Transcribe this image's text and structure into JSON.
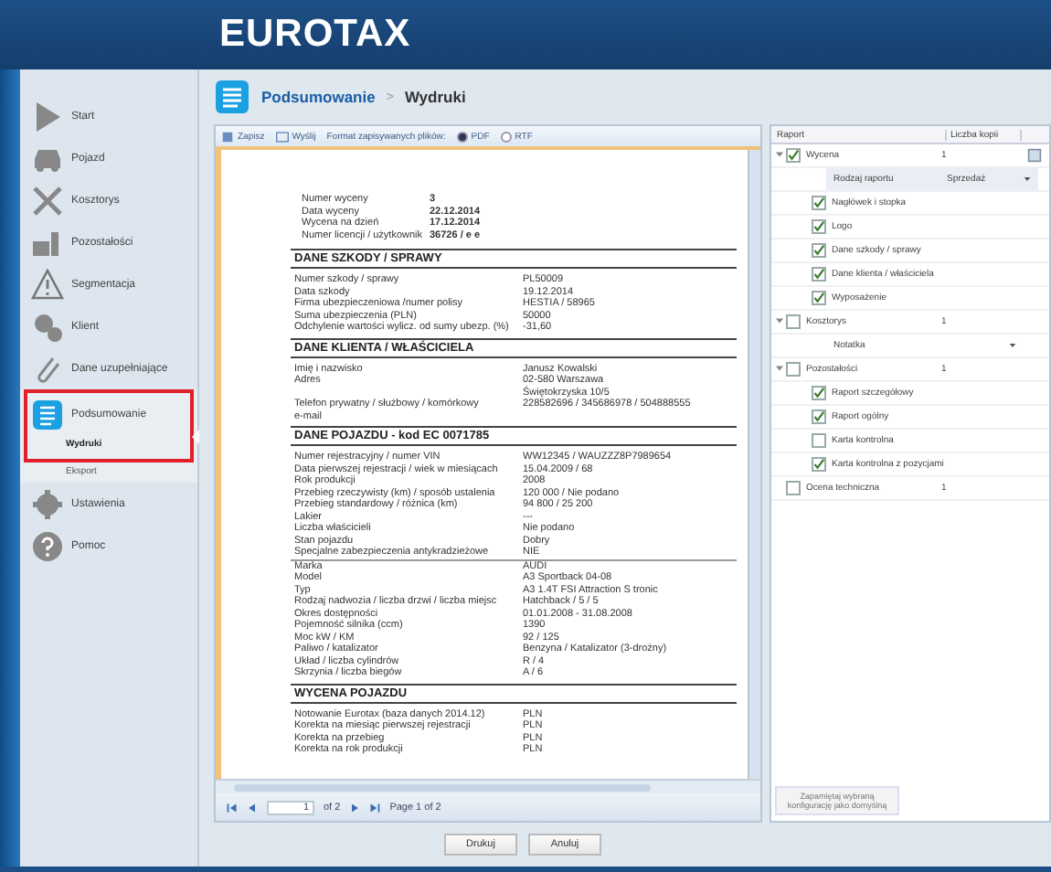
{
  "app": {
    "logo": "EUROTAX"
  },
  "sidebar": {
    "items": [
      {
        "label": "Start",
        "selected": false
      },
      {
        "label": "Pojazd",
        "selected": false
      },
      {
        "label": "Kosztorys",
        "selected": false
      },
      {
        "label": "Pozostałości",
        "selected": false
      },
      {
        "label": "Segmentacja",
        "selected": false
      },
      {
        "label": "Klient",
        "selected": false
      },
      {
        "label": "Dane uzupełniające",
        "selected": false
      },
      {
        "label": "Podsumowanie",
        "selected": true,
        "children": [
          {
            "label": "Wydruki",
            "selected": true
          },
          {
            "label": "Eksport",
            "selected": false
          }
        ]
      },
      {
        "label": "Ustawienia",
        "selected": false
      },
      {
        "label": "Pomoc",
        "selected": false
      }
    ]
  },
  "breadcrumb": [
    "Podsumowanie",
    ">",
    "Wydruki"
  ],
  "toolbar": {
    "save": "Zapisz",
    "send": "Wyślij",
    "format_label": "Format zapisywanych plików:",
    "formats": [
      {
        "label": "PDF",
        "selected": true
      },
      {
        "label": "RTF",
        "selected": false
      }
    ]
  },
  "document": {
    "header": [
      {
        "label": "Numer wyceny",
        "value": "3"
      },
      {
        "label": "Data wyceny",
        "value": "22.12.2014"
      },
      {
        "label": "Wycena na dzień",
        "value": "17.12.2014"
      },
      {
        "label": "Numer licencji / użytkownik",
        "value": "36726 / e e"
      }
    ],
    "sections": [
      {
        "title": "DANE SZKODY / SPRAWY",
        "rows": [
          {
            "label": "Numer szkody / sprawy",
            "value": "PL50009"
          },
          {
            "label": "Data szkody",
            "value": "19.12.2014"
          },
          {
            "label": "Firma ubezpieczeniowa /numer polisy",
            "value": "HESTIA / 58965"
          },
          {
            "label": "Suma ubezpieczenia (PLN)",
            "value": "50000"
          },
          {
            "label": "Odchylenie wartości wylicz. od sumy ubezp. (%)",
            "value": "-31,60"
          }
        ]
      },
      {
        "title": "DANE KLIENTA / WŁAŚCICIELA",
        "rows": [
          {
            "label": "Imię i nazwisko",
            "value": "Janusz Kowalski"
          },
          {
            "label": "Adres",
            "value": "02-580 Warszawa\nŚwiętokrzyska 10/5"
          },
          {
            "label": "Telefon prywatny / służbowy / komórkowy",
            "value": "228582696 / 345686978 / 504888555"
          },
          {
            "label": "e-mail"
          }
        ]
      },
      {
        "title": "DANE POJAZDU - kod EC 0071785",
        "rows": [
          {
            "label": "Numer rejestracyjny / numer VIN",
            "value": "WW12345 / WAUZZZ8P7989654"
          },
          {
            "label": "Data pierwszej rejestracji / wiek w miesiącach",
            "value": "15.04.2009 /  68"
          },
          {
            "label": "Rok produkcji",
            "value": "2008"
          },
          {
            "label": "Przebieg rzeczywisty (km) / sposób ustalenia",
            "value": "120 000 / Nie podano"
          },
          {
            "label": "Przebieg standardowy / różnica (km)",
            "value": "94 800 / 25 200"
          },
          {
            "label": "Lakier",
            "value": "---"
          },
          {
            "label": "Liczba właścicieli",
            "value": "Nie podano"
          },
          {
            "label": "Stan pojazdu",
            "value": "Dobry"
          },
          {
            "label": "Specjalne zabezpieczenia antykradzieżowe",
            "value": "NIE",
            "rule": true
          },
          {
            "label": "Marka",
            "value": "AUDI"
          },
          {
            "label": "Model",
            "value": "A3 Sportback 04-08"
          },
          {
            "label": "Typ",
            "value": "A3 1.4T FSI Attraction S tronic"
          },
          {
            "label": "Rodzaj nadwozia / liczba drzwi / liczba miejsc",
            "value": "Hatchback / 5 / 5"
          },
          {
            "label": "Okres dostępności",
            "value": "01.01.2008 - 31.08.2008"
          },
          {
            "label": "Pojemność silnika (ccm)",
            "value": "1390"
          },
          {
            "label": "Moc kW / KM",
            "value": "92 / 125"
          },
          {
            "label": "Paliwo / katalizator",
            "value": "Benzyna / Katalizator (3-drożny)"
          },
          {
            "label": "Układ / liczba cylindrów",
            "value": "R / 4"
          },
          {
            "label": "Skrzynia / liczba biegów",
            "value": "A / 6"
          }
        ]
      },
      {
        "title": "WYCENA POJAZDU",
        "rows": [
          {
            "label": "Notowanie Eurotax (baza danych 2014.12)",
            "value": "PLN"
          },
          {
            "label": "Korekta na miesiąc pierwszej rejestracji",
            "value": "PLN"
          },
          {
            "label": "Korekta na przebieg",
            "value": "PLN"
          },
          {
            "label": "Korekta na rok produkcji",
            "value": "PLN"
          }
        ]
      }
    ]
  },
  "pager": {
    "page": "1",
    "of": "of 2",
    "status": "Page 1 of 2"
  },
  "report_tree": {
    "columns": [
      "Raport",
      "Liczba kopii"
    ],
    "items": [
      {
        "label": "Wycena",
        "checked": true,
        "expanded": true,
        "copies": "1",
        "preview_icon": true,
        "children": [
          {
            "kind": "option",
            "label": "Rodzaj raportu",
            "value": "Sprzedaż"
          },
          {
            "kind": "check",
            "label": "Nagłówek i stopka",
            "checked": true
          },
          {
            "kind": "check",
            "label": "Logo",
            "checked": true
          },
          {
            "kind": "check",
            "label": "Dane szkody / sprawy",
            "checked": true
          },
          {
            "kind": "check",
            "label": "Dane klienta / właściciela",
            "checked": true
          },
          {
            "kind": "check",
            "label": "Wyposażenie",
            "checked": true
          }
        ]
      },
      {
        "label": "Kosztorys",
        "checked": false,
        "expanded": true,
        "copies": "1",
        "children": [
          {
            "kind": "option",
            "value": "Notatka"
          }
        ]
      },
      {
        "label": "Pozostałości",
        "checked": false,
        "expanded": true,
        "copies": "1",
        "children": [
          {
            "kind": "check",
            "label": "Raport szczegółowy",
            "checked": true
          },
          {
            "kind": "check",
            "label": "Raport ogólny",
            "checked": true
          },
          {
            "kind": "check",
            "label": "Karta kontrolna",
            "checked": false
          },
          {
            "kind": "check",
            "label": "Karta kontrolna z pozycjami",
            "checked": true
          }
        ]
      },
      {
        "label": "Ocena techniczna",
        "checked": false,
        "copies": "1"
      }
    ],
    "save_default": {
      "label": "Zapamiętaj wybraną konfigurację jako domyślną",
      "disabled": true
    }
  },
  "buttons": [
    "Drukuj",
    "Anuluj"
  ]
}
